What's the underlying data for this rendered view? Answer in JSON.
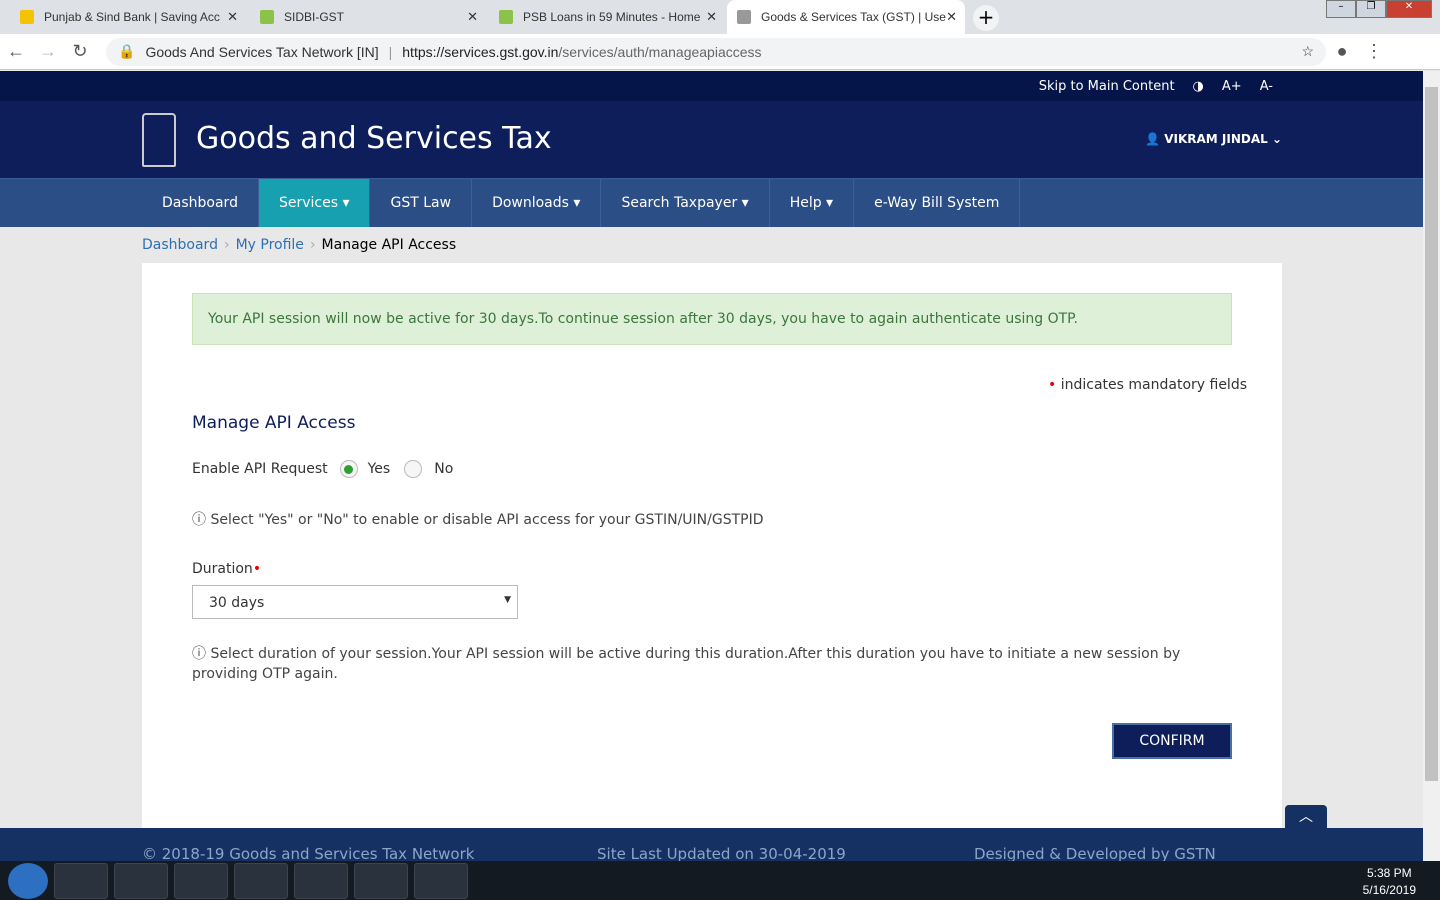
{
  "browser": {
    "tabs": [
      {
        "title": "Punjab & Sind Bank | Saving Acc"
      },
      {
        "title": "SIDBI-GST"
      },
      {
        "title": "PSB Loans in 59 Minutes - Home"
      },
      {
        "title": "Goods & Services Tax (GST) | Use"
      }
    ],
    "site_name": "Goods And Services Tax Network [IN]",
    "url_host": "https://services.gst.gov.in",
    "url_path": "/services/auth/manageapiaccess"
  },
  "topstrip": {
    "skip": "Skip to Main Content",
    "a_plus": "A+",
    "a_minus": "A-"
  },
  "header": {
    "title": "Goods and Services Tax",
    "user": "VIKRAM JINDAL"
  },
  "menu": [
    "Dashboard",
    "Services ▾",
    "GST Law",
    "Downloads ▾",
    "Search Taxpayer ▾",
    "Help ▾",
    "e-Way Bill System"
  ],
  "breadcrumb": [
    "Dashboard",
    "My Profile",
    "Manage API Access"
  ],
  "alert": "Your API session will now be active for 30 days.To continue session after 30 days, you have to again authenticate using OTP.",
  "mandatory": "indicates mandatory fields",
  "section_title": "Manage API Access",
  "enable_label": "Enable API Request",
  "yes": "Yes",
  "no": "No",
  "help1": "Select \"Yes\" or \"No\" to enable or disable API access for your GSTIN/UIN/GSTPID",
  "duration_label": "Duration",
  "duration_value": "30 days",
  "help2": "Select duration of your session.Your API session will be active during this duration.After this duration you have to initiate a new session by providing OTP again.",
  "confirm": "CONFIRM",
  "footer": {
    "copy": "© 2018-19 Goods and Services Tax Network",
    "updated": "Site Last Updated on 30-04-2019",
    "dev": "Designed & Developed by GSTN"
  },
  "clock": {
    "time": "5:38 PM",
    "date": "5/16/2019"
  }
}
